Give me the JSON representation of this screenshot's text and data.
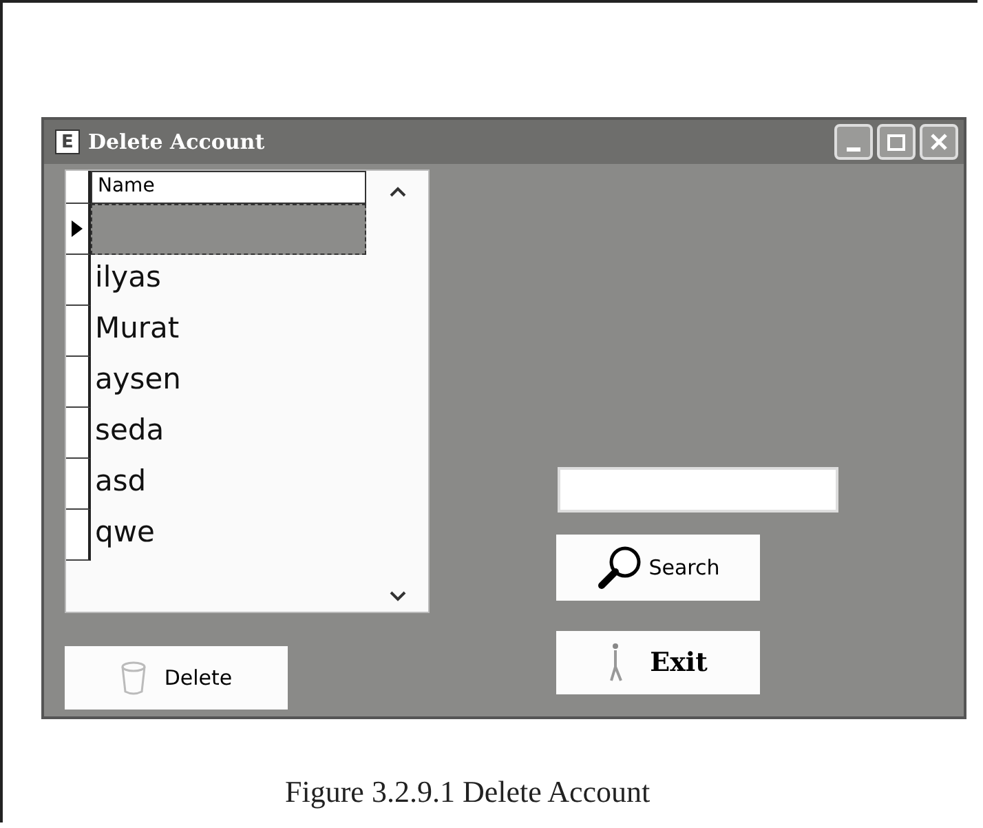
{
  "window": {
    "app_icon": "E",
    "title": "Delete Account"
  },
  "grid": {
    "columns": [
      "Name"
    ],
    "rows": [
      {
        "name": null,
        "selected": true
      },
      {
        "name": "ilyas",
        "selected": false
      },
      {
        "name": "Murat",
        "selected": false
      },
      {
        "name": "aysen",
        "selected": false
      },
      {
        "name": "seda",
        "selected": false
      },
      {
        "name": "asd",
        "selected": false
      },
      {
        "name": "qwe",
        "selected": false
      }
    ]
  },
  "buttons": [
    {
      "label": "Delete",
      "kind": "bin"
    },
    {
      "label": "Search",
      "kind": "magnifier"
    },
    {
      "label": "Exit",
      "kind": "door"
    }
  ],
  "caption": "Figure 3.2.9.1 Delete Account"
}
